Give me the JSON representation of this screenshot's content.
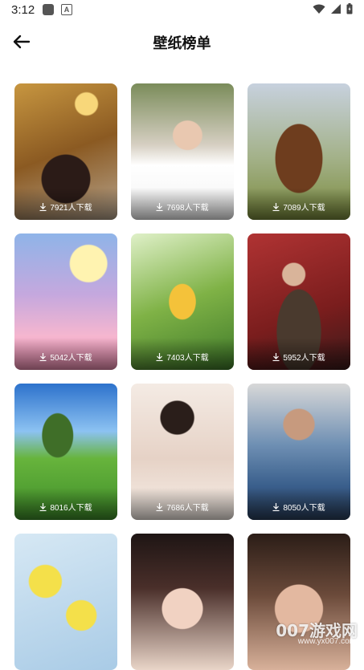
{
  "status_bar": {
    "time": "3:12",
    "icons": [
      "gallery-icon",
      "text-a-icon",
      "wifi-icon",
      "signal-icon",
      "battery-icon"
    ]
  },
  "header": {
    "title": "壁纸榜单",
    "back_icon": "arrow-left-icon"
  },
  "wallpapers": [
    {
      "downloads": "7921人下载"
    },
    {
      "downloads": "7698人下载"
    },
    {
      "downloads": "7089人下载"
    },
    {
      "downloads": "5042人下载"
    },
    {
      "downloads": "7403人下载"
    },
    {
      "downloads": "5952人下载"
    },
    {
      "downloads": "8016人下载"
    },
    {
      "downloads": "7686人下载"
    },
    {
      "downloads": "8050人下载"
    },
    {
      "downloads": ""
    },
    {
      "downloads": ""
    },
    {
      "downloads": ""
    }
  ],
  "watermark": {
    "main": "007游戏网",
    "sub": "www.yx007.com"
  }
}
